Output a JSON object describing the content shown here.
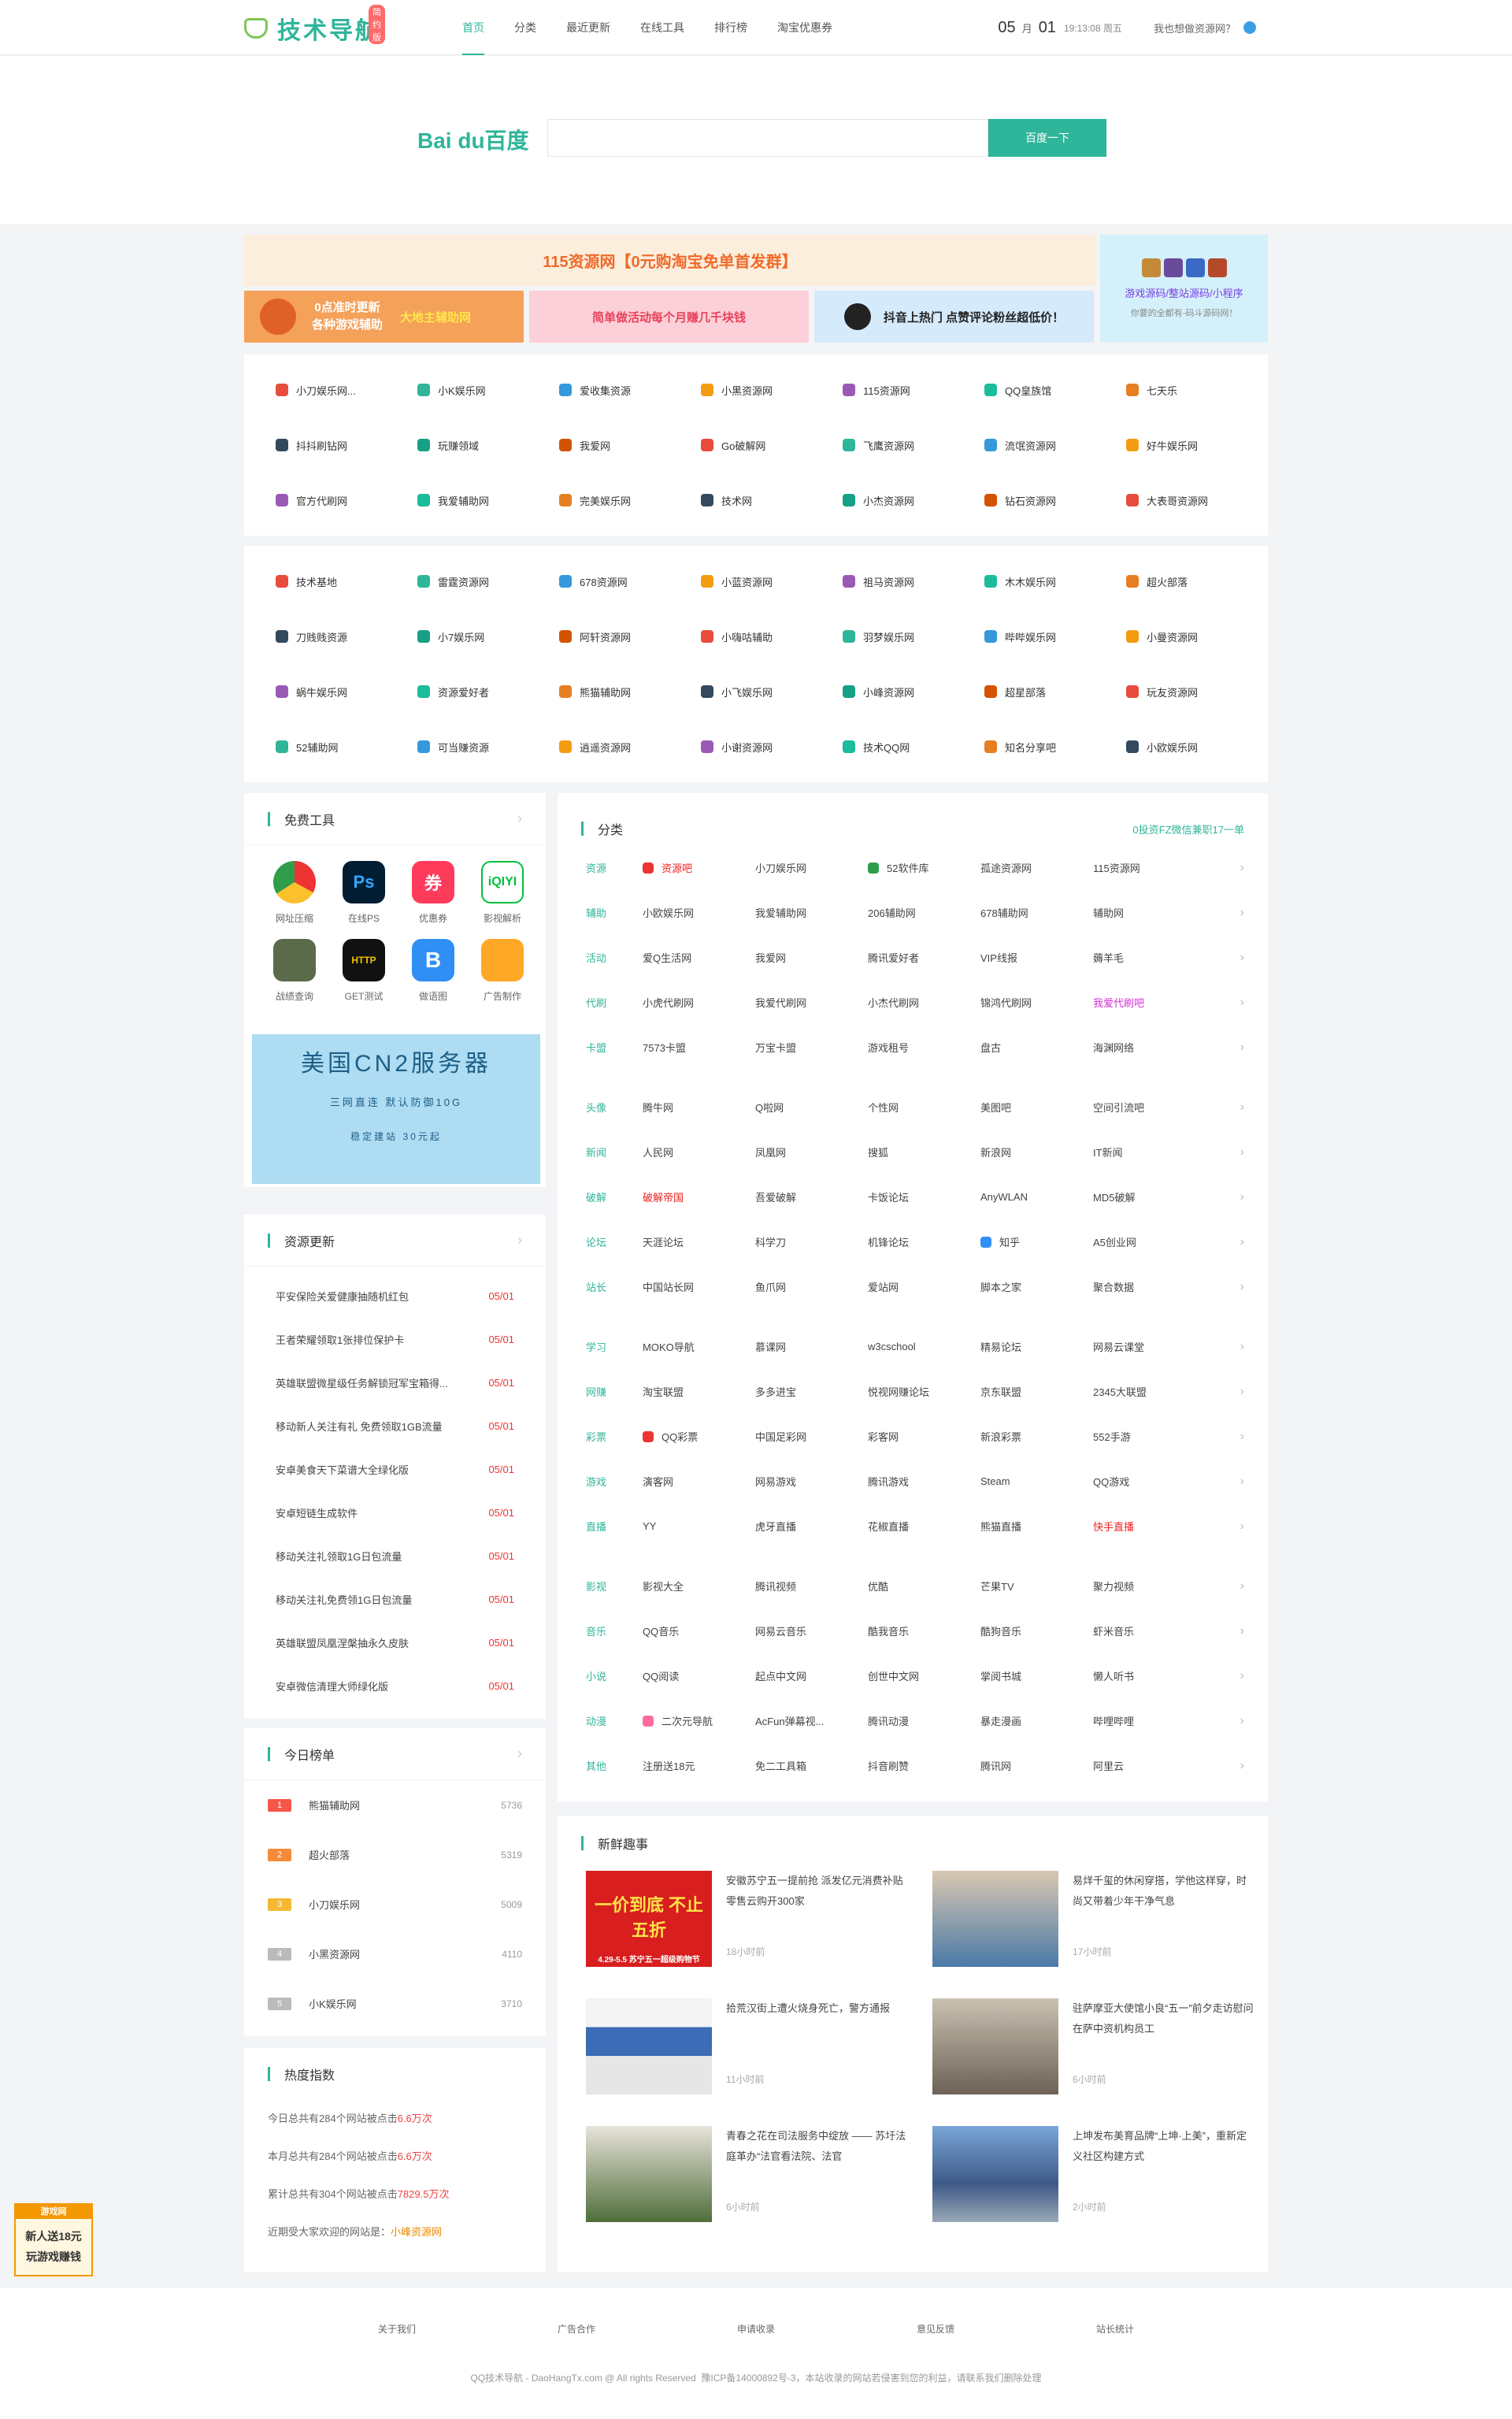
{
  "header": {
    "logo_text": "技术导航",
    "logo_badge": "简约版",
    "nav": [
      "首页",
      "分类",
      "最近更新",
      "在线工具",
      "排行榜",
      "淘宝优惠券"
    ],
    "date_month": "05",
    "date_month_unit": "月",
    "date_day": "01",
    "time": "19:13:08 周五",
    "link": "我也想做资源网？"
  },
  "search": {
    "engine": "Bai du百度",
    "button": "百度一下",
    "value": ""
  },
  "banners": {
    "top": "115资源网【0元购淘宝免单首发群】",
    "b1a": "0点准时更新",
    "b1b": "各种游戏辅助",
    "b1c": "大地主辅助网",
    "b2": "简单做活动每个月赚几千块钱",
    "b3": "抖音上热门 点赞评论粉丝超低价！",
    "side1": "游戏源码/整站源码/小程序",
    "side2": "你要的全都有-码斗源码网！",
    "ad_title": "美国CN2服务器",
    "ad_line1": "三网直连 默认防御10G",
    "ad_line2": "稳定建站 30元起"
  },
  "sites_block1": [
    "小刀娱乐网...",
    "小K娱乐网",
    "爱收集资源",
    "小黑资源网",
    "115资源网",
    "QQ皇族馆",
    "七天乐",
    "抖抖刷钻网",
    "玩赚领域",
    "我爱网",
    "Go破解网",
    "飞鹰资源网",
    "流氓资源网",
    "好牛娱乐网",
    "官方代刷网",
    "我爱辅助网",
    "完美娱乐网",
    "技术网",
    "小杰资源网",
    "钻石资源网",
    "大表哥资源网"
  ],
  "sites_block2": [
    "技术基地",
    "雷霆资源网",
    "678资源网",
    "小蓝资源网",
    "祖马资源网",
    "木木娱乐网",
    "超火部落",
    "刀贱贱资源",
    "小7娱乐网",
    "阿轩资源网",
    "小嗨咕辅助",
    "羽梦娱乐网",
    "哔哔娱乐网",
    "小曼资源网",
    "蜗牛娱乐网",
    "资源爱好者",
    "熊猫辅助网",
    "小飞娱乐网",
    "小峰资源网",
    "超星部落",
    "玩友资源网",
    "52辅助网",
    "可当赚资源",
    "逍遥资源网",
    "小谢资源网",
    "技术QQ网",
    "知名分享吧",
    "小欧娱乐网"
  ],
  "tools": {
    "title": "免费工具",
    "items": [
      "网址压缩",
      "在线PS",
      "优惠券",
      "影视解析",
      "战绩查询",
      "GET测试",
      "做语图",
      "广告制作"
    ]
  },
  "updates": {
    "title": "资源更新",
    "items": [
      {
        "t": "平安保险关爱健康抽随机红包",
        "d": "05/01"
      },
      {
        "t": "王者荣耀领取1张排位保护卡",
        "d": "05/01"
      },
      {
        "t": "英雄联盟微星级任务解锁冠军宝箱得...",
        "d": "05/01"
      },
      {
        "t": "移动新人关注有礼 免费领取1GB流量",
        "d": "05/01"
      },
      {
        "t": "安卓美食天下菜谱大全绿化版",
        "d": "05/01"
      },
      {
        "t": "安卓短链生成软件",
        "d": "05/01"
      },
      {
        "t": "移动关注礼领取1G日包流量",
        "d": "05/01"
      },
      {
        "t": "移动关注礼免费领1G日包流量",
        "d": "05/01"
      },
      {
        "t": "英雄联盟凤凰涅槃抽永久皮肤",
        "d": "05/01"
      },
      {
        "t": "安卓微信清理大师绿化版",
        "d": "05/01"
      }
    ]
  },
  "today_rank": {
    "title": "今日榜单",
    "items": [
      {
        "n": "1",
        "t": "熊猫辅助网",
        "v": "5736"
      },
      {
        "n": "2",
        "t": "超火部落",
        "v": "5319"
      },
      {
        "n": "3",
        "t": "小刀娱乐网",
        "v": "5009"
      },
      {
        "n": "4",
        "t": "小黑资源网",
        "v": "4110"
      },
      {
        "n": "5",
        "t": "小K娱乐网",
        "v": "3710"
      }
    ]
  },
  "heat": {
    "title": "热度指数",
    "l1a": "今日总共有284个网站被点击",
    "l1b": "6.6万次",
    "l2a": "本月总共有284个网站被点击",
    "l2b": "6.6万次",
    "l3a": "累计总共有304个网站被点击",
    "l3b": "7829.5万次",
    "l4a": "近期受大家欢迎的网站是：",
    "l4b": "小峰资源网"
  },
  "category": {
    "title": "分类",
    "note": "0投资FZ微信兼职17一单",
    "rows": [
      {
        "c": "资源",
        "items": [
          "资源吧",
          "小刀娱乐网",
          "52软件库",
          "孤途资源网",
          "115资源网"
        ]
      },
      {
        "c": "辅助",
        "items": [
          "小欧娱乐网",
          "我爱辅助网",
          "206辅助网",
          "678辅助网",
          "辅助网"
        ]
      },
      {
        "c": "活动",
        "items": [
          "爱Q生活网",
          "我爱网",
          "腾讯爱好者",
          "VIP线报",
          "薅羊毛"
        ]
      },
      {
        "c": "代刷",
        "items": [
          "小虎代刷网",
          "我爱代刷网",
          "小杰代刷网",
          "锦鸿代刷网",
          "我爱代刷吧"
        ]
      },
      {
        "c": "卡盟",
        "items": [
          "7573卡盟",
          "万宝卡盟",
          "游戏租号",
          "盘古",
          "海渊网络"
        ]
      },
      {
        "c": "头像",
        "items": [
          "腾牛网",
          "Q啦网",
          "个性网",
          "美图吧",
          "空间引流吧"
        ]
      },
      {
        "c": "新闻",
        "items": [
          "人民网",
          "凤凰网",
          "搜狐",
          "新浪网",
          "IT新闻"
        ]
      },
      {
        "c": "破解",
        "items": [
          "破解帝国",
          "吾爱破解",
          "卡饭论坛",
          "AnyWLAN",
          "MD5破解"
        ]
      },
      {
        "c": "论坛",
        "items": [
          "天涯论坛",
          "科学刀",
          "机锋论坛",
          "知乎",
          "A5创业网"
        ]
      },
      {
        "c": "站长",
        "items": [
          "中国站长网",
          "鱼爪网",
          "爱站网",
          "脚本之家",
          "聚合数据"
        ]
      },
      {
        "c": "学习",
        "items": [
          "MOKO导航",
          "慕课网",
          "w3cschool",
          "精易论坛",
          "网易云课堂"
        ]
      },
      {
        "c": "网赚",
        "items": [
          "淘宝联盟",
          "多多进宝",
          "悦视网赚论坛",
          "京东联盟",
          "2345大联盟"
        ]
      },
      {
        "c": "彩票",
        "items": [
          "QQ彩票",
          "中国足彩网",
          "彩客网",
          "新浪彩票",
          "552手游"
        ]
      },
      {
        "c": "游戏",
        "items": [
          "演客网",
          "网易游戏",
          "腾讯游戏",
          "Steam",
          "QQ游戏"
        ]
      },
      {
        "c": "直播",
        "items": [
          "YY",
          "虎牙直播",
          "花椒直播",
          "熊猫直播",
          "快手直播"
        ]
      },
      {
        "c": "影视",
        "items": [
          "影视大全",
          "腾讯视频",
          "优酷",
          "芒果TV",
          "聚力视频"
        ]
      },
      {
        "c": "音乐",
        "items": [
          "QQ音乐",
          "网易云音乐",
          "酷我音乐",
          "酷狗音乐",
          "虾米音乐"
        ]
      },
      {
        "c": "小说",
        "items": [
          "QQ阅读",
          "起点中文网",
          "创世中文网",
          "掌阅书城",
          "懒人听书"
        ]
      },
      {
        "c": "动漫",
        "items": [
          "二次元导航",
          "AcFun弹幕视...",
          "腾讯动漫",
          "暴走漫画",
          "哔哩哔哩"
        ]
      },
      {
        "c": "其他",
        "items": [
          "注册送18元",
          "免二工具箱",
          "抖音刷赞",
          "腾讯网",
          "阿里云"
        ]
      }
    ]
  },
  "news": {
    "title": "新鲜趣事",
    "items": [
      {
        "t": "安徽苏宁五一提前抢 派发亿元消费补贴 零售云购开300家",
        "tm": "18小时前"
      },
      {
        "t": "易烊千玺的休闲穿搭，学他这样穿，时尚又带着少年干净气息",
        "tm": "17小时前"
      },
      {
        "t": "拾荒汉街上遭火烧身死亡，警方通报",
        "tm": "11小时前"
      },
      {
        "t": "驻萨摩亚大使馆小良“五一”前夕走访慰问在萨中资机构员工",
        "tm": "6小时前"
      },
      {
        "t": "青春之花在司法服务中绽放 —— 苏圩法庭革办“法官看法院、法官",
        "tm": "6小时前"
      },
      {
        "t": "上坤发布美育品牌“上坤·上美”，重新定义社区构建方式",
        "tm": "2小时前"
      }
    ],
    "img1_text": "一价到底 不止五折",
    "img1_sub": "4.29-5.5 苏宁五一超级购物节"
  },
  "float_ad": {
    "top": "游戏网",
    "l1": "新人送18元",
    "l2": "玩游戏赚钱"
  },
  "footer": {
    "links": [
      "关于我们",
      "广告合作",
      "申请收录",
      "意见反馈",
      "站长统计"
    ],
    "copy": "QQ技术导航 - DaoHangTx.com @ All rights Reserved",
    "icp": "豫ICP备14000892号-3，本站收录的网站若侵害到您的利益，请联系我们删除处理"
  },
  "colors": {
    "accent": "#2fb59a",
    "red": "#e33333"
  }
}
